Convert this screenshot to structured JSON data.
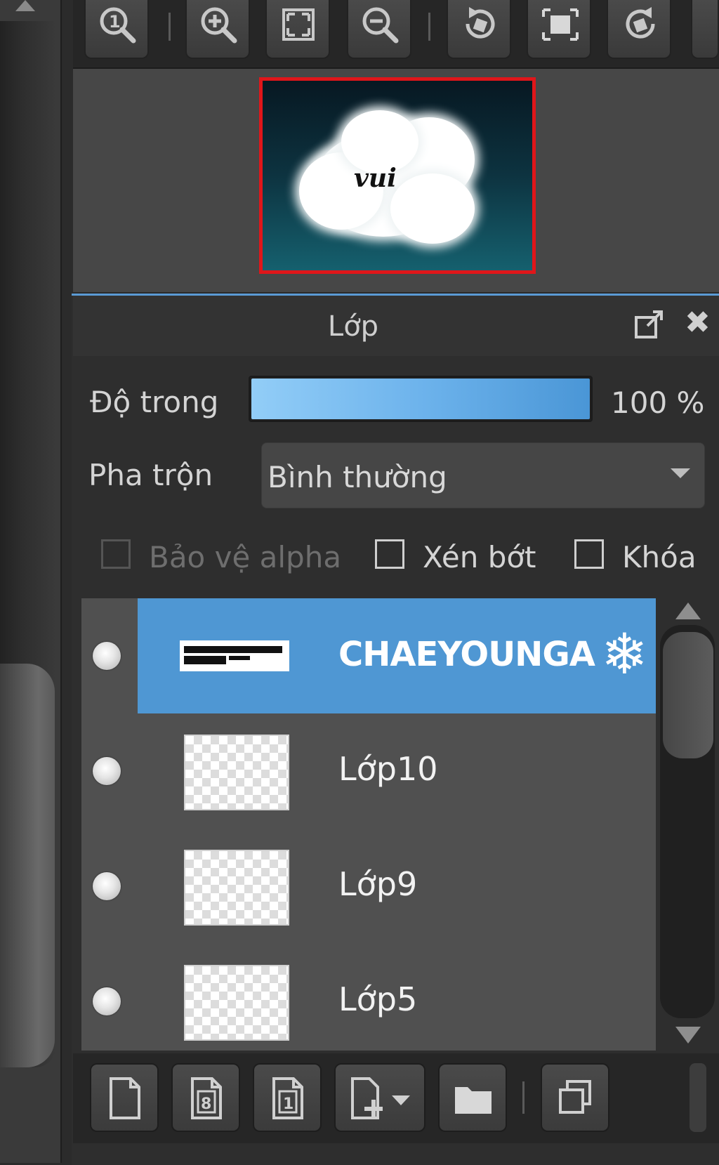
{
  "toolbar": {
    "buttons": [
      {
        "icon": "zoom-actual-size-icon"
      },
      {
        "icon": "zoom-in-icon"
      },
      {
        "icon": "fit-to-screen-icon"
      },
      {
        "icon": "zoom-out-icon"
      },
      {
        "icon": "rotate-left-icon"
      },
      {
        "icon": "reset-rotation-icon"
      },
      {
        "icon": "rotate-right-icon"
      }
    ]
  },
  "navigator": {
    "preview_text": "vui"
  },
  "layers_panel": {
    "title": "Lớp",
    "opacity_label": "Độ trong",
    "opacity_value": "100 %",
    "opacity_level": 1.0,
    "blend_label": "Pha trộn",
    "blend_value": "Bình thường",
    "protect_alpha_label": "Bảo vệ alpha",
    "clipping_label": "Xén bớt",
    "lock_label": "Khóa",
    "layers": [
      {
        "name": "CHAEYOUNGA",
        "selected": true,
        "visible": true
      },
      {
        "name": "Lớp10",
        "selected": false,
        "visible": true
      },
      {
        "name": "Lớp9",
        "selected": false,
        "visible": true
      },
      {
        "name": "Lớp5",
        "selected": false,
        "visible": true
      }
    ],
    "bottom_buttons": [
      {
        "icon": "new-color-layer-icon"
      },
      {
        "icon": "new-8bit-layer-icon"
      },
      {
        "icon": "new-1bit-layer-icon"
      },
      {
        "icon": "add-layer-menu-icon"
      },
      {
        "icon": "new-folder-icon"
      },
      {
        "icon": "duplicate-layer-icon"
      }
    ]
  },
  "colors": {
    "accent": "#5b9bd5",
    "selected_row": "#4f97d3",
    "navigator_frame": "#e0161a"
  }
}
